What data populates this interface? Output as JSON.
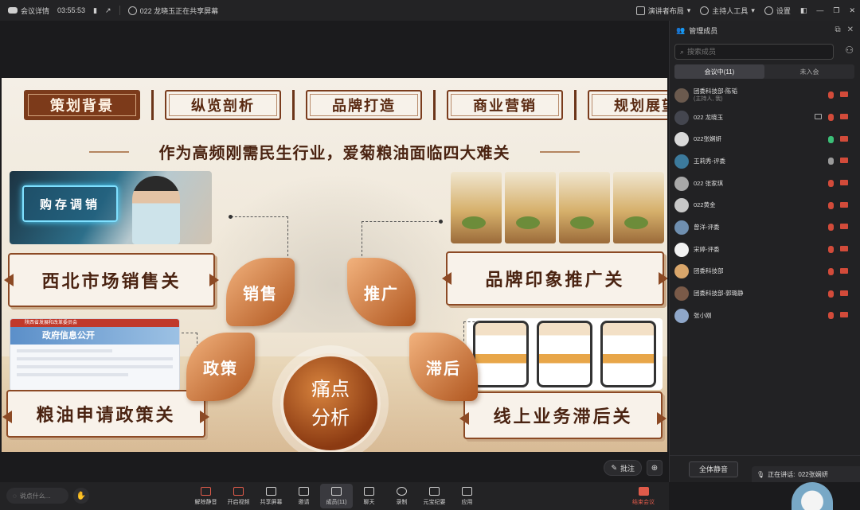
{
  "topbar": {
    "meeting_details": "会议详情",
    "duration": "03:55:53",
    "sharing_status": "022 龙晓玉正在共享屏幕",
    "layout": "演讲者布局",
    "host_tools": "主持人工具",
    "settings": "设置"
  },
  "slide": {
    "nav": [
      "策划背景",
      "纵览剖析",
      "品牌打造",
      "商业营销",
      "规划展望"
    ],
    "active_nav": 0,
    "headline": "作为高频刚需民生行业，爱菊粮油面临四大难关",
    "image_caption": "购存调销",
    "gov_site_bar": "陕西省发展和改革委员会",
    "gov_site_title": "政府信息公开",
    "cards": [
      "西北市场销售关",
      "品牌印象推广关",
      "粮油申请政策关",
      "线上业务滞后关"
    ],
    "petals": [
      "销售",
      "推广",
      "政策",
      "滞后"
    ],
    "center": [
      "痛点",
      "分析"
    ]
  },
  "stage_tools": {
    "annotate": "批注"
  },
  "panel": {
    "title": "管理成员",
    "search_placeholder": "搜索成员",
    "tabs": [
      "会议中(11)",
      "未入会"
    ],
    "members": [
      {
        "name": "团委科技部-陈韬",
        "sub": "(主持人, 我)",
        "avatar_color": "#6b5a4e"
      },
      {
        "name": "022 龙晓玉",
        "sub": "",
        "avatar_color": "#44464f"
      },
      {
        "name": "022张娴妍",
        "sub": "",
        "avatar_color": "#d9d9d9"
      },
      {
        "name": "王莉秀-评委",
        "sub": "",
        "avatar_color": "#3c7a9c"
      },
      {
        "name": "022 张家琪",
        "sub": "",
        "avatar_color": "#a8a8a8"
      },
      {
        "name": "022黄金",
        "sub": "",
        "avatar_color": "#c8c8c8"
      },
      {
        "name": "曾洋-评委",
        "sub": "",
        "avatar_color": "#6f8fb0"
      },
      {
        "name": "宋婷-评委",
        "sub": "",
        "avatar_color": "#f2f2f2"
      },
      {
        "name": "团委科技部",
        "sub": "",
        "avatar_color": "#d9a66b"
      },
      {
        "name": "团委科技部-郭璐静",
        "sub": "",
        "avatar_color": "#7a5a48"
      },
      {
        "name": "张小刚",
        "sub": "",
        "avatar_color": "#8fa7c9"
      }
    ],
    "mute_all": "全体静音"
  },
  "speaking": {
    "label": "正在讲话:",
    "name": "022张娴妍"
  },
  "bottombar": {
    "say_placeholder": "说点什么...",
    "tools": [
      "解除静音",
      "开启视频",
      "共享屏幕",
      "邀请",
      "成员(11)",
      "聊天",
      "录制",
      "元宝纪要",
      "应用"
    ],
    "selected_tool": 4,
    "end": "结束会议"
  }
}
